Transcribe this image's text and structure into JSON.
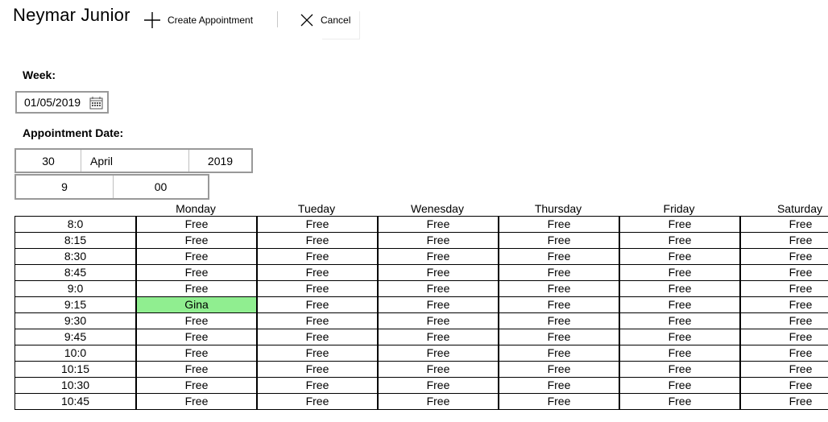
{
  "window": {
    "title": "Neymar Junior"
  },
  "commands": {
    "create_label": "Create Appointment",
    "cancel_label": "Cancel"
  },
  "week": {
    "label": "Week:",
    "value": "01/05/2019"
  },
  "appointment": {
    "label": "Appointment Date:",
    "day": "30",
    "month": "April",
    "year": "2019",
    "hour": "9",
    "minute": "00"
  },
  "schedule": {
    "days": [
      "Monday",
      "Tueday",
      "Wenesday",
      "Thursday",
      "Friday",
      "Saturday"
    ],
    "slots": [
      "8:0",
      "8:15",
      "8:30",
      "8:45",
      "9:0",
      "9:15",
      "9:30",
      "9:45",
      "10:0",
      "10:15",
      "10:30",
      "10:45"
    ],
    "cells": [
      [
        "Free",
        "Free",
        "Free",
        "Free",
        "Free",
        "Free"
      ],
      [
        "Free",
        "Free",
        "Free",
        "Free",
        "Free",
        "Free"
      ],
      [
        "Free",
        "Free",
        "Free",
        "Free",
        "Free",
        "Free"
      ],
      [
        "Free",
        "Free",
        "Free",
        "Free",
        "Free",
        "Free"
      ],
      [
        "Free",
        "Free",
        "Free",
        "Free",
        "Free",
        "Free"
      ],
      [
        "Gina",
        "Free",
        "Free",
        "Free",
        "Free",
        "Free"
      ],
      [
        "Free",
        "Free",
        "Free",
        "Free",
        "Free",
        "Free"
      ],
      [
        "Free",
        "Free",
        "Free",
        "Free",
        "Free",
        "Free"
      ],
      [
        "Free",
        "Free",
        "Free",
        "Free",
        "Free",
        "Free"
      ],
      [
        "Free",
        "Free",
        "Free",
        "Free",
        "Free",
        "Free"
      ],
      [
        "Free",
        "Free",
        "Free",
        "Free",
        "Free",
        "Free"
      ],
      [
        "Free",
        "Free",
        "Free",
        "Free",
        "Free",
        "Free"
      ]
    ],
    "booked_color": "#90ee90"
  }
}
